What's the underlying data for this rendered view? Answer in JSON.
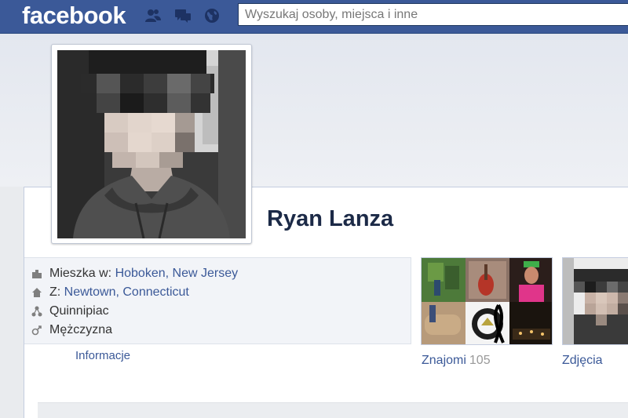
{
  "topbar": {
    "logo": "facebook",
    "search_placeholder": "Wyszukaj osoby, miejsca i inne",
    "jewels": [
      "friend-requests-icon",
      "messages-icon",
      "notifications-globe-icon"
    ],
    "bg_color": "#3b5998"
  },
  "profile": {
    "name": "Ryan Lanza",
    "about": {
      "lives_prefix": "Mieszka w: ",
      "lives_value": "Hoboken, New Jersey",
      "from_prefix": "Z: ",
      "from_value": "Newtown, Connecticut",
      "school": "Quinnipiac",
      "gender": "Mężczyzna"
    },
    "info_link": "Informacje"
  },
  "tiles": {
    "friends_label": "Znajomi",
    "friends_count": "105",
    "photos_label": "Zdjęcia"
  },
  "colors": {
    "link": "#3b5998",
    "name": "#1c2a47"
  }
}
